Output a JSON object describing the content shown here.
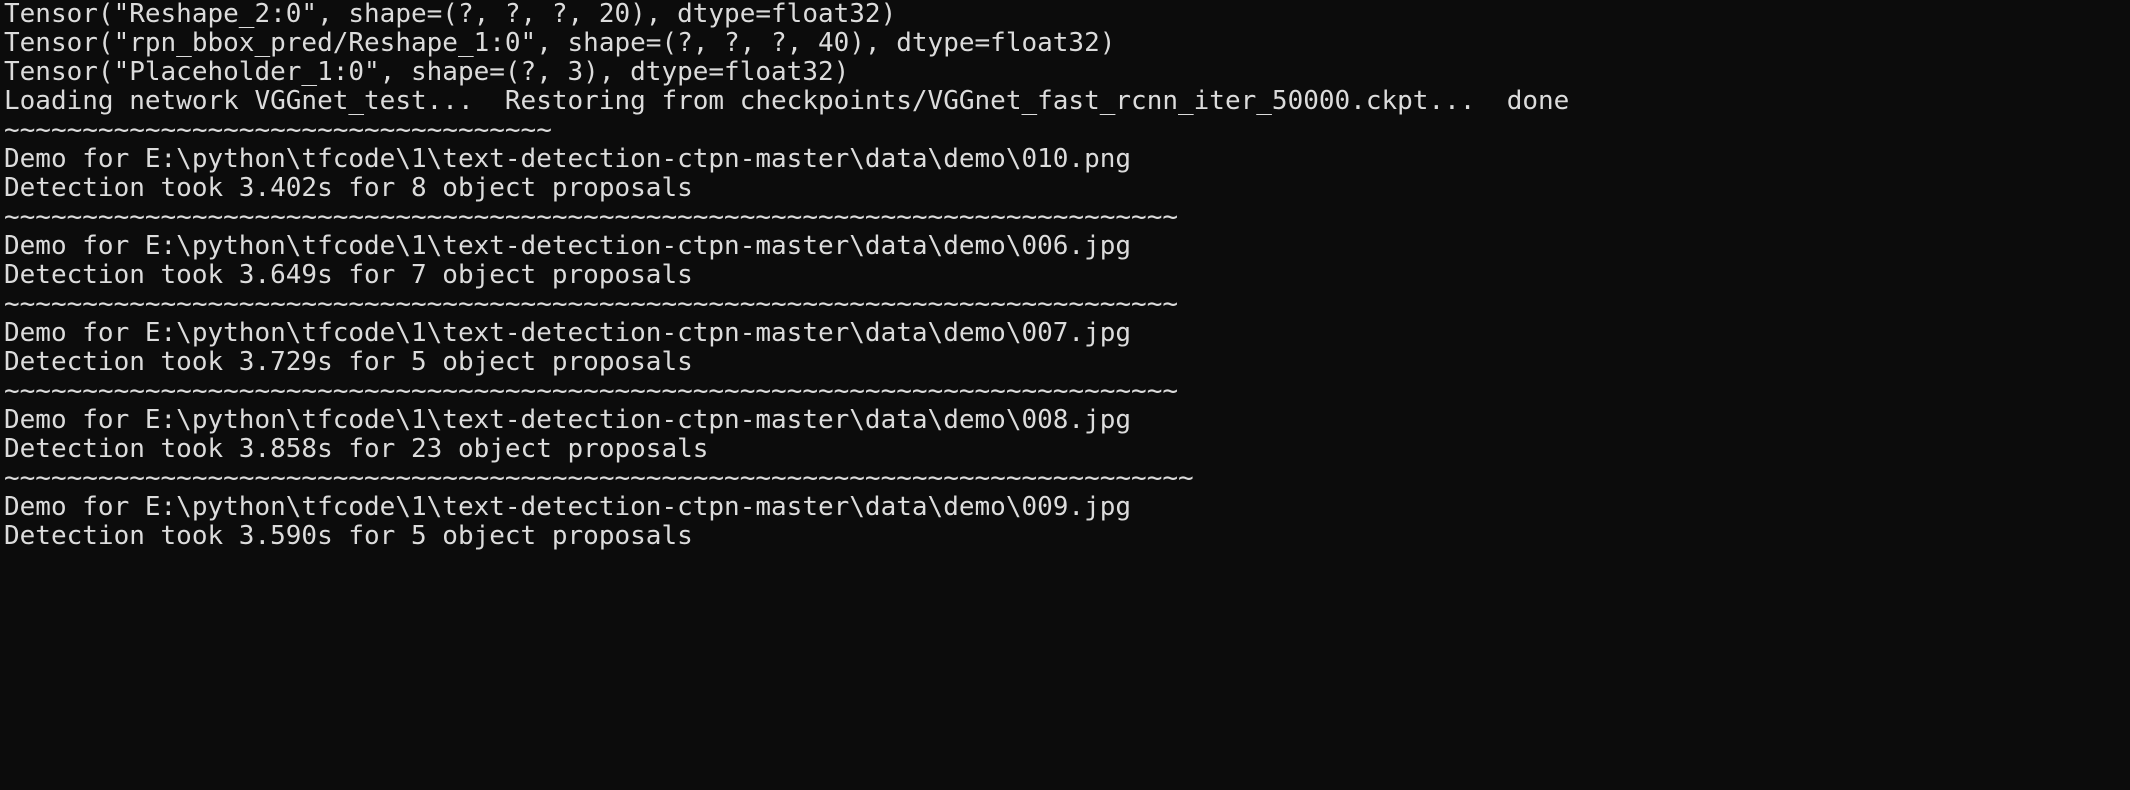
{
  "terminal": {
    "lines": [
      "Tensor(\"Reshape_2:0\", shape=(?, ?, ?, 20), dtype=float32)",
      "Tensor(\"rpn_bbox_pred/Reshape_1:0\", shape=(?, ?, ?, 40), dtype=float32)",
      "Tensor(\"Placeholder_1:0\", shape=(?, 3), dtype=float32)",
      "Loading network VGGnet_test...  Restoring from checkpoints/VGGnet_fast_rcnn_iter_50000.ckpt...  done",
      "~~~~~~~~~~~~~~~~~~~~~~~~~~~~~~~~~~~",
      "Demo for E:\\python\\tfcode\\1\\text-detection-ctpn-master\\data\\demo\\010.png",
      "Detection took 3.402s for 8 object proposals",
      "~~~~~~~~~~~~~~~~~~~~~~~~~~~~~~~~~~~~~~~~~~~~~~~~~~~~~~~~~~~~~~~~~~~~~~~~~~~",
      "Demo for E:\\python\\tfcode\\1\\text-detection-ctpn-master\\data\\demo\\006.jpg",
      "Detection took 3.649s for 7 object proposals",
      "~~~~~~~~~~~~~~~~~~~~~~~~~~~~~~~~~~~~~~~~~~~~~~~~~~~~~~~~~~~~~~~~~~~~~~~~~~~",
      "Demo for E:\\python\\tfcode\\1\\text-detection-ctpn-master\\data\\demo\\007.jpg",
      "Detection took 3.729s for 5 object proposals",
      "~~~~~~~~~~~~~~~~~~~~~~~~~~~~~~~~~~~~~~~~~~~~~~~~~~~~~~~~~~~~~~~~~~~~~~~~~~~",
      "Demo for E:\\python\\tfcode\\1\\text-detection-ctpn-master\\data\\demo\\008.jpg",
      "Detection took 3.858s for 23 object proposals",
      "~~~~~~~~~~~~~~~~~~~~~~~~~~~~~~~~~~~~~~~~~~~~~~~~~~~~~~~~~~~~~~~~~~~~~~~~~~~~",
      "Demo for E:\\python\\tfcode\\1\\text-detection-ctpn-master\\data\\demo\\009.jpg",
      "Detection took 3.590s for 5 object proposals"
    ]
  }
}
